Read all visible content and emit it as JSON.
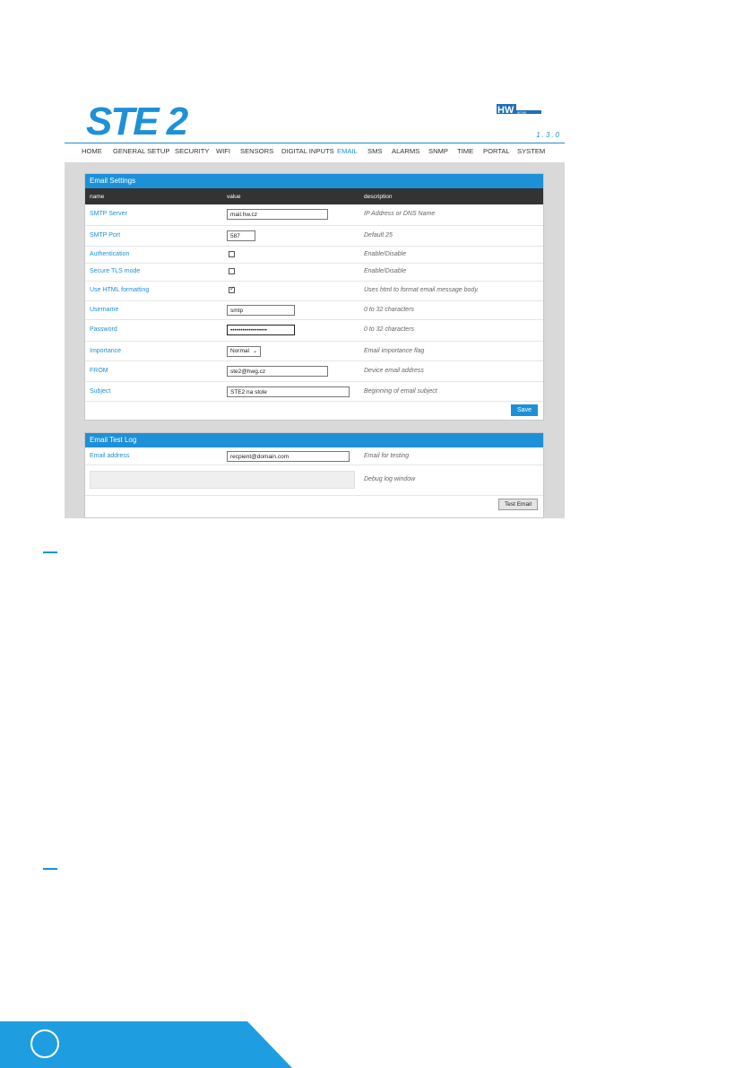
{
  "brand": {
    "logo_text": "STE 2",
    "hw_logo_text": "HW group",
    "version": "1.3.0"
  },
  "nav": [
    {
      "label": "HOME"
    },
    {
      "label": "GENERAL SETUP"
    },
    {
      "label": "SECURITY"
    },
    {
      "label": "WIFI"
    },
    {
      "label": "SENSORS"
    },
    {
      "label": "DIGITAL INPUTS"
    },
    {
      "label": "EMAIL"
    },
    {
      "label": "SMS"
    },
    {
      "label": "ALARMS"
    },
    {
      "label": "SNMP"
    },
    {
      "label": "TIME"
    },
    {
      "label": "PORTAL"
    },
    {
      "label": "SYSTEM"
    }
  ],
  "nav_active": "EMAIL",
  "email_settings": {
    "title": "Email Settings",
    "columns": {
      "name": "name",
      "value": "value",
      "description": "description"
    },
    "rows": {
      "smtp_server": {
        "label": "SMTP Server",
        "value": "mail.hw.cz",
        "desc": "IP Address or DNS Name"
      },
      "smtp_port": {
        "label": "SMTP Port",
        "value": "587",
        "desc": "Default 25"
      },
      "authentication": {
        "label": "Authentication",
        "checked": false,
        "desc": "Enable/Disable"
      },
      "secure_tls": {
        "label": "Secure TLS mode",
        "checked": false,
        "desc": "Enable/Disable"
      },
      "html_formatting": {
        "label": "Use HTML formatting",
        "checked": true,
        "desc": "Uses html to format email message body."
      },
      "username": {
        "label": "Username",
        "value": "smtp",
        "desc": "0 to 32 characters"
      },
      "password": {
        "label": "Password",
        "value": "••••••••••••••••••",
        "desc": "0 to 32 characters"
      },
      "importance": {
        "label": "Importance",
        "value": "Normal",
        "desc": "Email importance flag"
      },
      "from": {
        "label": "FROM",
        "value": "ste2@hwg.cz",
        "desc": "Device email address"
      },
      "subject": {
        "label": "Subject",
        "value": "STE2 na stole",
        "desc": "Beginning of email subject"
      }
    },
    "save_label": "Save"
  },
  "email_test_log": {
    "title": "Email Test Log",
    "email_address": {
      "label": "Email address",
      "value": "recpient@domain.com",
      "desc": "Email for testing"
    },
    "debug_desc": "Debug log window",
    "test_label": "Test Email"
  },
  "colors": {
    "accent": "#1e90d8",
    "header_dark": "#333333",
    "footer": "#1e9ee0"
  }
}
